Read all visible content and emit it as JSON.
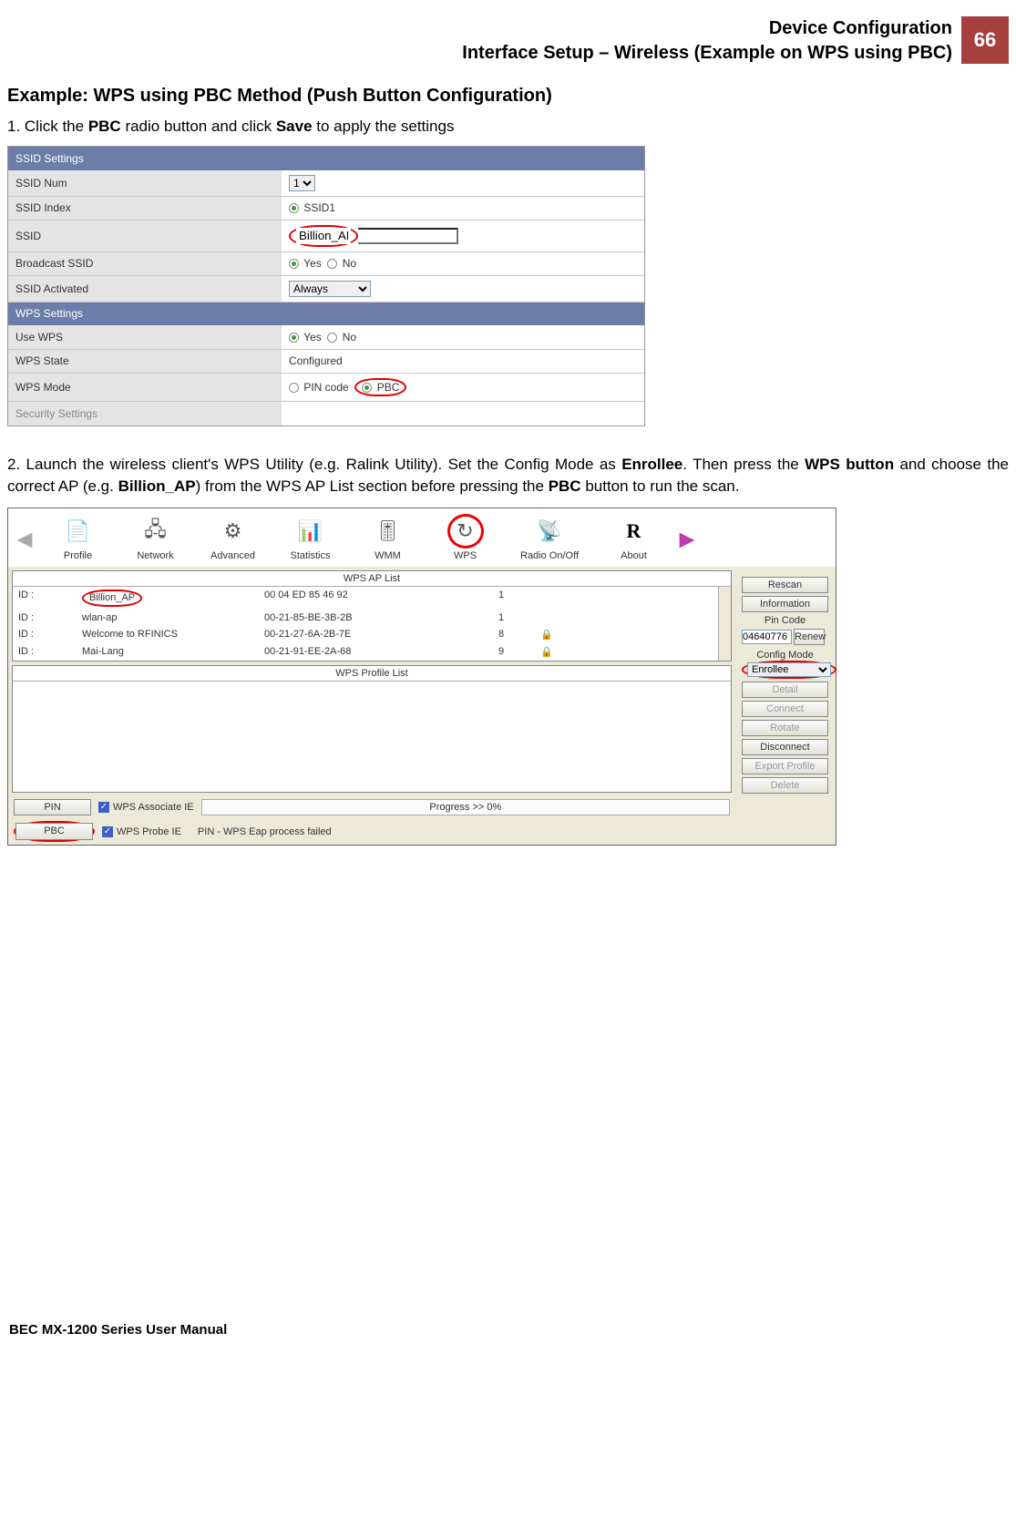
{
  "header": {
    "title1": "Device Configuration",
    "title2": "Interface Setup – Wireless (Example on WPS using PBC)",
    "page_number": "66"
  },
  "example_title": "Example: WPS using PBC Method (Push Button Configuration)",
  "step1": {
    "prefix": "1.  Click the ",
    "b1": "PBC",
    "mid": " radio button and click ",
    "b2": "Save",
    "suffix": " to apply the settings"
  },
  "router": {
    "sec1": "SSID Settings",
    "ssid_num_label": "SSID Num",
    "ssid_num_value": "1",
    "ssid_index_label": "SSID Index",
    "ssid_index_value": "SSID1",
    "ssid_label": "SSID",
    "ssid_value": "Billion_AP",
    "broadcast_label": "Broadcast SSID",
    "yes": "Yes",
    "no": "No",
    "activated_label": "SSID Activated",
    "activated_value": "Always",
    "sec2": "WPS Settings",
    "use_wps_label": "Use WPS",
    "wps_state_label": "WPS State",
    "wps_state_value": "Configured",
    "wps_mode_label": "WPS Mode",
    "pin_code": "PIN code",
    "pbc": "PBC",
    "sec3": "Security Settings"
  },
  "step2": {
    "prefix": "2.  Launch the wireless client's WPS Utility (e.g. Ralink Utility). Set the Config Mode as ",
    "b1": "Enrollee",
    "mid1": ". Then press the ",
    "b2": "WPS button",
    "mid2": " and choose the correct AP (e.g. ",
    "b3": "Billion_AP",
    "mid3": ") from the WPS AP List section before pressing the ",
    "b4": "PBC",
    "suffix": " button to run the scan."
  },
  "ralink": {
    "toolbar": [
      "Profile",
      "Network",
      "Advanced",
      "Statistics",
      "WMM",
      "WPS",
      "Radio On/Off",
      "About"
    ],
    "aplist_hdr": "WPS AP List",
    "profilelist_hdr": "WPS Profile List",
    "rows": [
      {
        "id": "ID :",
        "name": "Billion_AP",
        "mac": "00 04 ED 85 46 92",
        "ch": "1",
        "sec": ""
      },
      {
        "id": "ID :",
        "name": "wlan-ap",
        "mac": "00-21-85-BE-3B-2B",
        "ch": "1",
        "sec": ""
      },
      {
        "id": "ID :",
        "name": "Welcome to RFINICS",
        "mac": "00-21-27-6A-2B-7E",
        "ch": "8",
        "sec": "🔒"
      },
      {
        "id": "ID :",
        "name": "Mai-Lang",
        "mac": "00-21-91-EE-2A-68",
        "ch": "9",
        "sec": "🔒"
      }
    ],
    "side": {
      "rescan": "Rescan",
      "information": "Information",
      "pincode_label": "Pin Code",
      "pincode_value": "04640776",
      "renew": "Renew",
      "config_mode": "Config Mode",
      "enrollee": "Enrollee",
      "detail": "Detail",
      "connect": "Connect",
      "rotate": "Rotate",
      "disconnect": "Disconnect",
      "export": "Export Profile",
      "delete": "Delete"
    },
    "bottom": {
      "pin": "PIN",
      "pbc": "PBC",
      "assoc": "WPS Associate IE",
      "probe": "WPS Probe IE",
      "progress": "Progress >> 0%",
      "status": "PIN - WPS Eap process failed"
    }
  },
  "footer": "BEC MX-1200 Series User Manual"
}
